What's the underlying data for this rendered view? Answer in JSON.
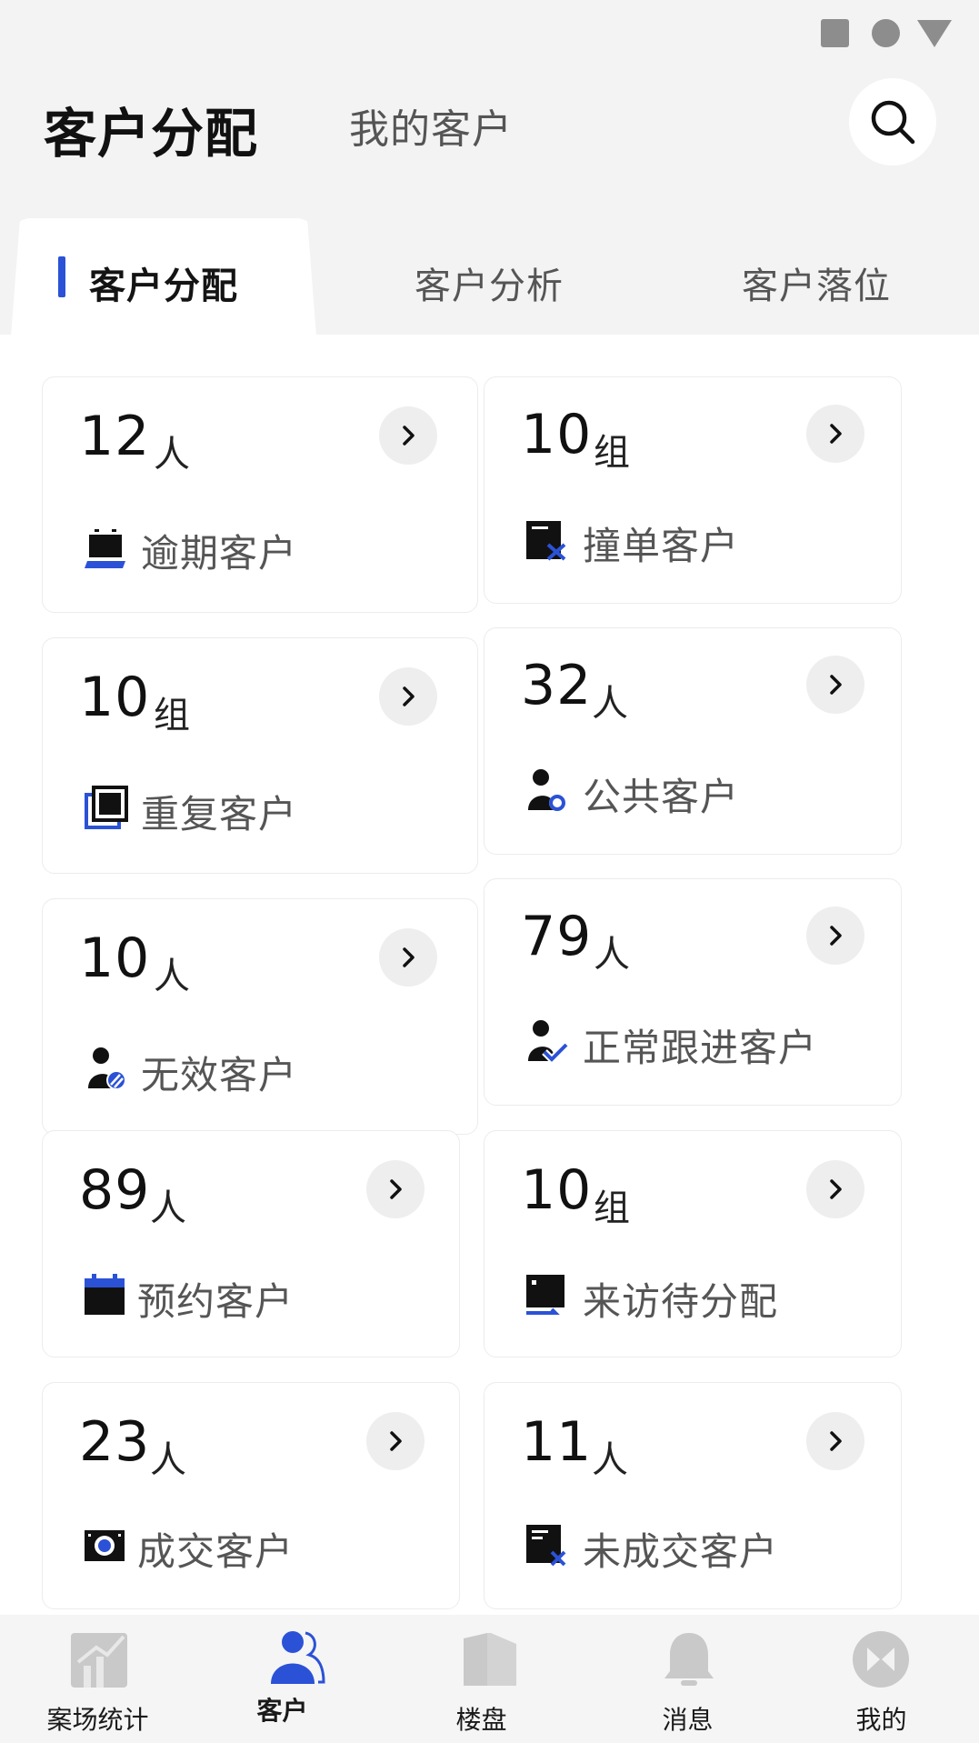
{
  "header": {
    "title": "客户分配",
    "secondary_title": "我的客户"
  },
  "tabs": [
    {
      "label": "客户分配",
      "active": true
    },
    {
      "label": "客户分析",
      "active": false
    },
    {
      "label": "客户落位",
      "active": false
    }
  ],
  "cards": [
    {
      "number": "12",
      "unit": "人",
      "label": "逾期客户",
      "icon": "overdue-calendar-icon"
    },
    {
      "number": "10",
      "unit": "组",
      "label": "撞单客户",
      "icon": "conflict-order-icon"
    },
    {
      "number": "10",
      "unit": "组",
      "label": "重复客户",
      "icon": "duplicate-icon"
    },
    {
      "number": "32",
      "unit": "人",
      "label": "公共客户",
      "icon": "public-customer-icon"
    },
    {
      "number": "10",
      "unit": "人",
      "label": "无效客户",
      "icon": "invalid-customer-icon"
    },
    {
      "number": "79",
      "unit": "人",
      "label": "正常跟进客户",
      "icon": "follow-up-customer-icon"
    },
    {
      "number": "89",
      "unit": "人",
      "label": "预约客户",
      "icon": "appointment-calendar-icon"
    },
    {
      "number": "10",
      "unit": "组",
      "label": "来访待分配",
      "icon": "visit-pending-icon"
    },
    {
      "number": "23",
      "unit": "人",
      "label": "成交客户",
      "icon": "deal-customer-icon"
    },
    {
      "number": "11",
      "unit": "人",
      "label": "未成交客户",
      "icon": "no-deal-customer-icon"
    }
  ],
  "bottom_nav": [
    {
      "label": "案场统计",
      "icon": "stats-chart-icon",
      "active": false
    },
    {
      "label": "客户",
      "icon": "customer-icon",
      "active": true
    },
    {
      "label": "楼盘",
      "icon": "building-icon",
      "active": false
    },
    {
      "label": "消息",
      "icon": "bell-icon",
      "active": false
    },
    {
      "label": "我的",
      "icon": "profile-icon",
      "active": false
    }
  ],
  "colors": {
    "accent": "#2b52d6",
    "header_bg": "#f3f3f3",
    "nav_inactive_icon": "#c9c9c9"
  }
}
